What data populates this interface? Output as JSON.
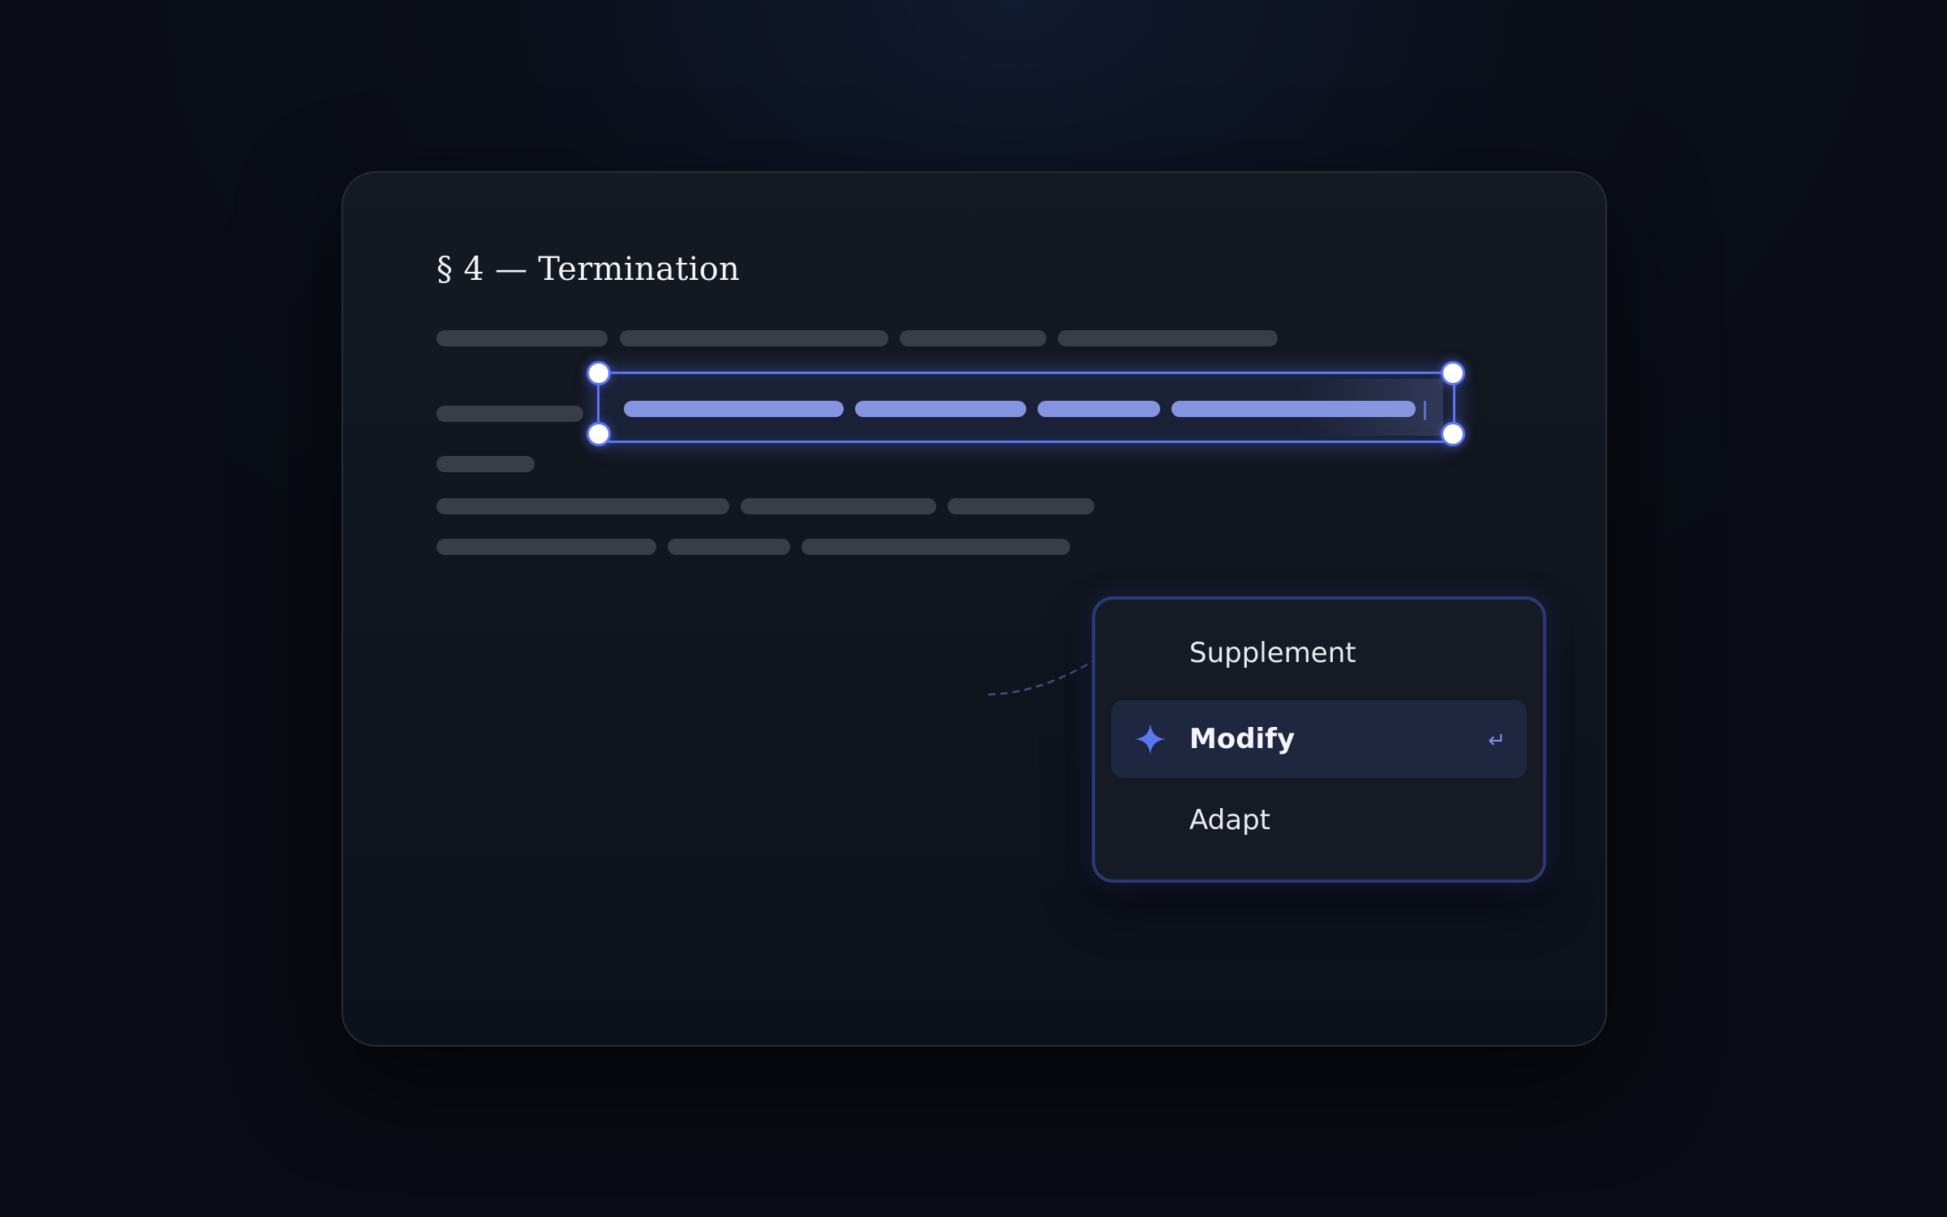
{
  "document": {
    "section_title": "§ 4 — Termination"
  },
  "context_menu": {
    "items": [
      {
        "label": "Supplement",
        "icon": null,
        "selected": false
      },
      {
        "label": "Modify",
        "icon": "sparkle-icon",
        "selected": true,
        "shortcut": "↵"
      },
      {
        "label": "Adapt",
        "icon": null,
        "selected": false
      }
    ]
  },
  "colors": {
    "accent": "#5b75ee",
    "selection_text": "#8594e0",
    "placeholder_text": "#393d46",
    "background": "#0b0f1a"
  }
}
